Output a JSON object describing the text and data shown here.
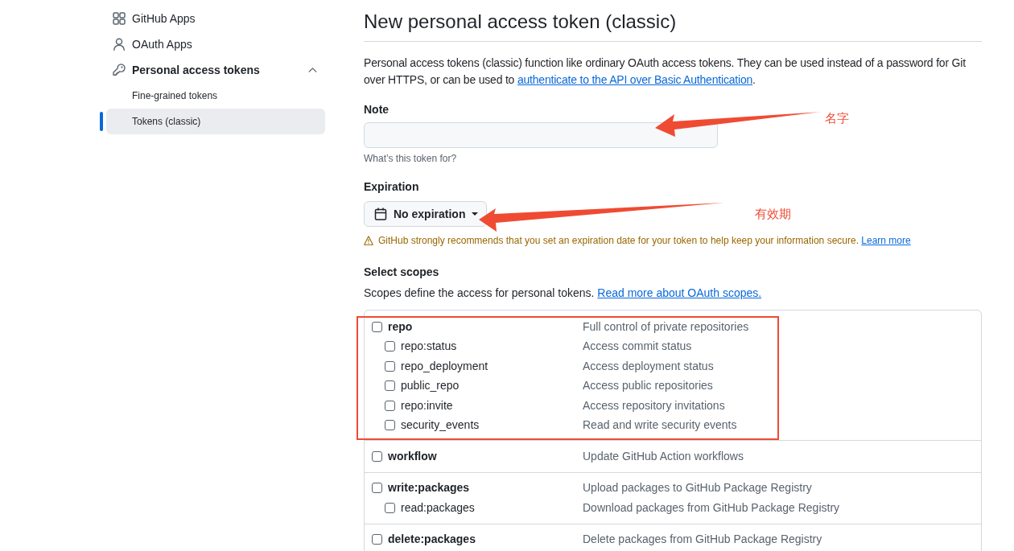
{
  "sidebar": {
    "items": [
      {
        "label": "GitHub Apps",
        "selected": false
      },
      {
        "label": "OAuth Apps",
        "selected": false
      },
      {
        "label": "Personal access tokens",
        "selected": false,
        "expanded": true,
        "children": [
          {
            "label": "Fine-grained tokens",
            "selected": false
          },
          {
            "label": "Tokens (classic)",
            "selected": true
          }
        ]
      }
    ]
  },
  "header": {
    "title": "New personal access token (classic)"
  },
  "intro": {
    "text": "Personal access tokens (classic) function like ordinary OAuth access tokens. They can be used instead of a password for Git over HTTPS, or can be used to ",
    "link": "authenticate to the API over Basic Authentication",
    "end": "."
  },
  "note": {
    "label": "Note",
    "hint": "What’s this token for?"
  },
  "expiration": {
    "label": "Expiration",
    "value": "No expiration",
    "warning": "GitHub strongly recommends that you set an expiration date for your token to help keep your information secure.",
    "warning_link": "Learn more"
  },
  "scopes": {
    "title": "Select scopes",
    "description": "Scopes define the access for personal tokens.",
    "link": "Read more about OAuth scopes.",
    "groups": [
      {
        "name": "repo",
        "description": "Full control of private repositories",
        "checked": false,
        "children": [
          {
            "name": "repo:status",
            "description": "Access commit status",
            "checked": false
          },
          {
            "name": "repo_deployment",
            "description": "Access deployment status",
            "checked": false
          },
          {
            "name": "public_repo",
            "description": "Access public repositories",
            "checked": false
          },
          {
            "name": "repo:invite",
            "description": "Access repository invitations",
            "checked": false
          },
          {
            "name": "security_events",
            "description": "Read and write security events",
            "checked": false
          }
        ]
      },
      {
        "name": "workflow",
        "description": "Update GitHub Action workflows",
        "checked": false
      },
      {
        "name": "write:packages",
        "description": "Upload packages to GitHub Package Registry",
        "checked": false,
        "children": [
          {
            "name": "read:packages",
            "description": "Download packages from GitHub Package Registry",
            "checked": false
          }
        ]
      },
      {
        "name": "delete:packages",
        "description": "Delete packages from GitHub Package Registry",
        "checked": false
      }
    ]
  },
  "annotations": [
    {
      "text": "名字"
    },
    {
      "text": "有效期"
    }
  ]
}
